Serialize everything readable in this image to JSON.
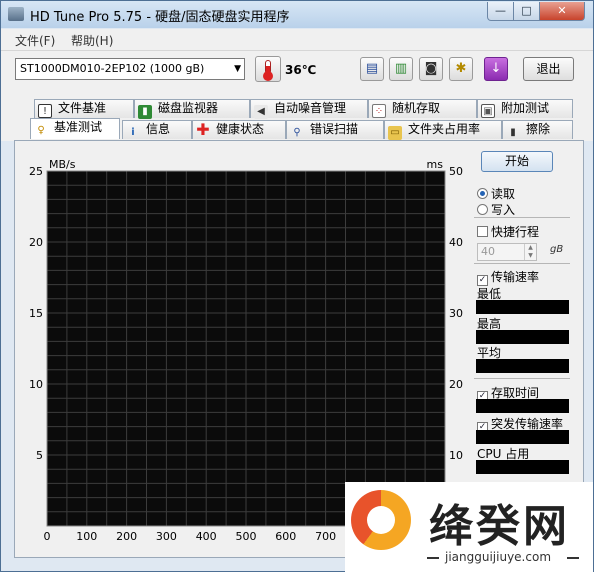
{
  "window": {
    "title": "HD Tune Pro 5.75 - 硬盘/固态硬盘实用程序"
  },
  "title_controls": {
    "minimize": "—",
    "maximize": "□",
    "close": "✕"
  },
  "menu": {
    "items": [
      "文件(F)",
      "帮助(H)"
    ]
  },
  "toolbar": {
    "drive": "ST1000DM010-2EP102 (1000 gB)",
    "temperature": "36℃",
    "exit_label": "退出",
    "icons": [
      "copy-text-icon",
      "copy-screen-icon",
      "camera-icon",
      "settings-icon",
      "download-icon"
    ]
  },
  "tabs": {
    "row1": [
      "文件基准",
      "磁盘监视器",
      "自动噪音管理",
      "随机存取",
      "附加测试"
    ],
    "row2": [
      "基准测试",
      "信息",
      "健康状态",
      "错误扫描",
      "文件夹占用率",
      "擦除"
    ],
    "active": "基准测试"
  },
  "chart_data": {
    "type": "line",
    "y_left_label": "MB/s",
    "y_right_label": "ms",
    "y_left_ticks": [
      "25",
      "20",
      "15",
      "10",
      "5"
    ],
    "y_right_ticks": [
      "50",
      "40",
      "30",
      "20",
      "10"
    ],
    "x_ticks": [
      "0",
      "100",
      "200",
      "300",
      "400",
      "500",
      "600",
      "700"
    ],
    "ylim_left": [
      0,
      25
    ],
    "ylim_right": [
      0,
      50
    ],
    "grid": true,
    "series": []
  },
  "side_panel": {
    "start_label": "开始",
    "mode_read": "读取",
    "mode_write": "写入",
    "quick_stroke_label": "快捷行程",
    "quick_stroke_value": "40",
    "quick_stroke_unit": "gB",
    "transfer_rate_label": "传输速率",
    "min_label": "最低",
    "max_label": "最高",
    "avg_label": "平均",
    "access_time_label": "存取时间",
    "burst_rate_label": "突发传输速率",
    "cpu_label": "CPU 占用"
  },
  "watermark": {
    "title": "绛癸网",
    "url": "jiangguijiuye.com"
  }
}
